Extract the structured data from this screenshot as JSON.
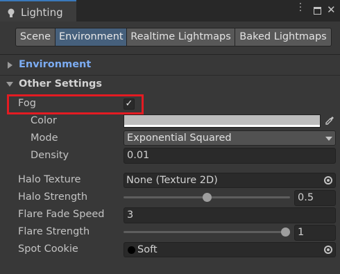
{
  "window": {
    "title": "Lighting",
    "menu_icon": "kebab-menu-icon",
    "maximize_icon": "maximize-icon",
    "close_icon": "close-icon"
  },
  "tabs": [
    {
      "label": "Scene",
      "active": false
    },
    {
      "label": "Environment",
      "active": true
    },
    {
      "label": "Realtime Lightmaps",
      "active": false
    },
    {
      "label": "Baked Lightmaps",
      "active": false
    }
  ],
  "sections": {
    "environment": {
      "label": "Environment",
      "expanded": false
    },
    "other_settings": {
      "label": "Other Settings",
      "expanded": true
    }
  },
  "fog": {
    "label": "Fog",
    "checked": true,
    "check_glyph": "✓",
    "color_label": "Color",
    "color_value": "#bdbdbd",
    "mode_label": "Mode",
    "mode_value": "Exponential Squared",
    "density_label": "Density",
    "density_value": "0.01"
  },
  "halo_texture": {
    "label": "Halo Texture",
    "value": "None (Texture 2D)"
  },
  "halo_strength": {
    "label": "Halo Strength",
    "value": "0.5",
    "fraction": 0.5
  },
  "flare_fade_speed": {
    "label": "Flare Fade Speed",
    "value": "3"
  },
  "flare_strength": {
    "label": "Flare Strength",
    "value": "1",
    "fraction": 1.0
  },
  "spot_cookie": {
    "label": "Spot Cookie",
    "value": "Soft"
  },
  "colors": {
    "accent_blue": "#7cacf2",
    "active_tab": "#46607c",
    "highlight": "#e41b22"
  }
}
